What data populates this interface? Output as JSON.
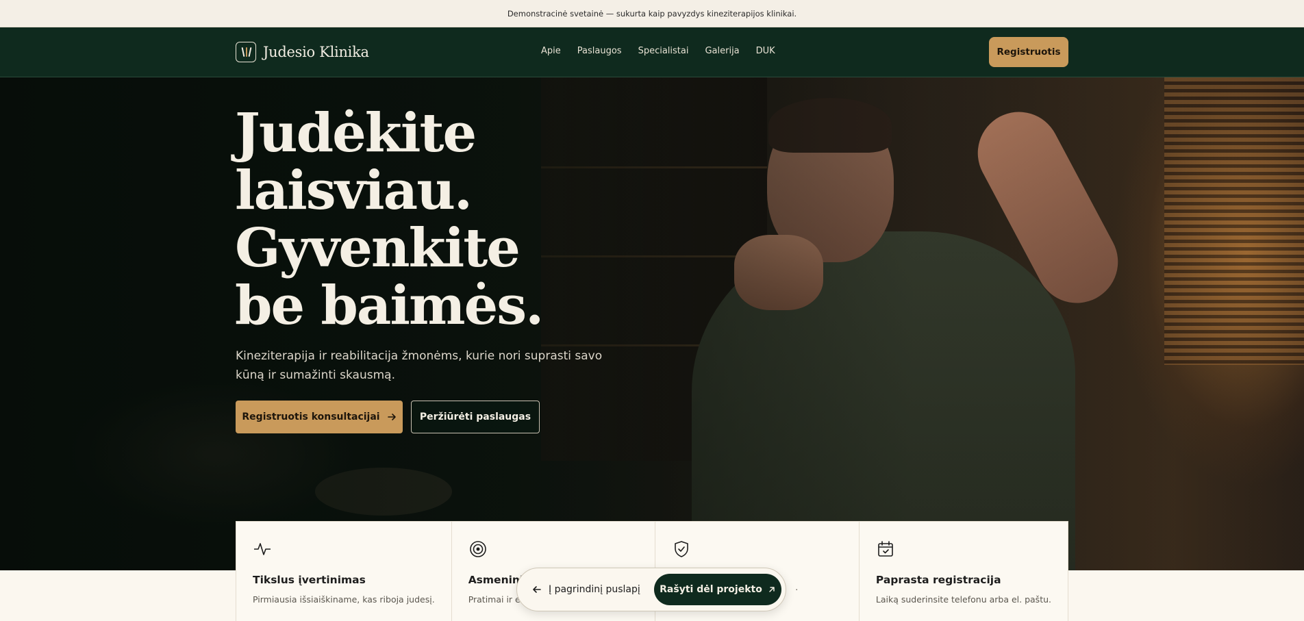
{
  "topbar": {
    "text": "Demonstracinė svetainė — sukurta kaip pavyzdys kineziterapijos klinikai."
  },
  "nav": {
    "brand": "Judesio Klinika",
    "links": [
      "Apie",
      "Paslaugos",
      "Specialistai",
      "Galerija",
      "DUK"
    ],
    "cta": "Registruotis"
  },
  "hero": {
    "headline": [
      "Judėkite",
      "laisviau.",
      "Gyvenkite",
      "be baimės."
    ],
    "lead": "Kineziterapija ir reabilitacija žmonėms, kurie nori suprasti savo kūną ir sumažinti skausmą.",
    "primary_button": "Registruotis konsultacijai",
    "secondary_button": "Peržiūrėti paslaugas"
  },
  "features": [
    {
      "icon": "pulse-icon",
      "title": "Tikslus įvertinimas",
      "text": "Pirmiausia išsiaiškiname, kas riboja judesį."
    },
    {
      "icon": "target-icon",
      "title": "Asmeninis p",
      "text": "Pratimai ir eiga p"
    },
    {
      "icon": "shield-check-icon",
      "title": "",
      "text": "."
    },
    {
      "icon": "calendar-check-icon",
      "title": "Paprasta registracija",
      "text": "Laiką suderinsite telefonu arba el. paštu."
    }
  ],
  "floating_bar": {
    "back_label": "Į pagrindinį puslapį",
    "write_label": "Rašyti dėl projekto"
  },
  "colors": {
    "accent": "#c99a5b",
    "dark_green": "#0f2a1e",
    "cream": "#fbf7ef"
  }
}
